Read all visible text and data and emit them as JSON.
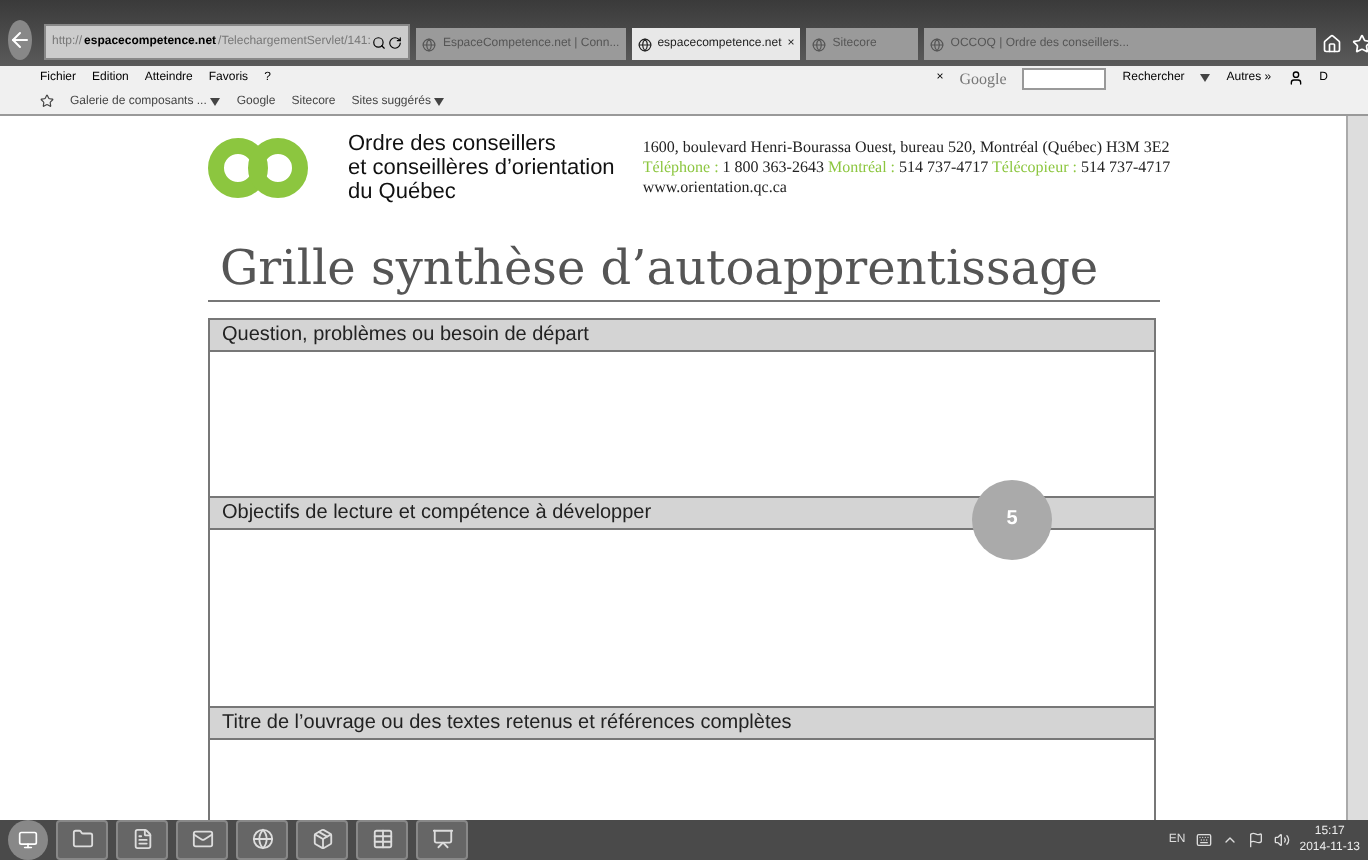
{
  "browser": {
    "address_host": "http://",
    "address_domain": "espacecompetence.net",
    "address_path": "/TelechargementServlet/141:",
    "tabs": [
      {
        "label": "EspaceCompetence.net | Conn...",
        "selected": false
      },
      {
        "label": "espacecompetence.net",
        "selected": true,
        "close": "×"
      },
      {
        "label": "Sitecore",
        "selected": false
      },
      {
        "label": "OCCOQ | Ordre des conseillers...",
        "selected": false
      }
    ],
    "menu": [
      "Fichier",
      "Edition",
      "Atteindre",
      "Favoris",
      "?"
    ],
    "search_close": "×",
    "search_engine": "Google",
    "search_button": "Rechercher",
    "others": "Autres »",
    "user_initial": "D",
    "favorites": [
      {
        "label": "Galerie de composants ...",
        "dropdown": true
      },
      {
        "label": "Google",
        "dropdown": false
      },
      {
        "label": "Sitecore",
        "dropdown": false
      },
      {
        "label": "Sites suggérés",
        "dropdown": true
      }
    ]
  },
  "document": {
    "org_name": [
      "Ordre des conseillers",
      "et conseillères d’orientation",
      "du Québec"
    ],
    "address": "1600, boulevard Henri-Bourassa Ouest, bureau 520, Montréal (Québec)  H3M 3E2",
    "contacts": [
      {
        "label": "Téléphone :",
        "value": "1 800 363-2643"
      },
      {
        "label": "Montréal :",
        "value": "514 737-4717"
      },
      {
        "label": "Télécopieur :",
        "value": "514 737-4717"
      }
    ],
    "website": "www.orientation.qc.ca",
    "title": "Grille synthèse d’autoapprentissage",
    "sections": [
      "Question, problèmes ou besoin de départ",
      "Objectifs de lecture et compétence à développer",
      "Titre de l’ouvrage ou des textes retenus et références complètes"
    ],
    "page_number": "5"
  },
  "taskbar": {
    "language": "EN",
    "time": "15:17",
    "date": "2014-11-13"
  }
}
